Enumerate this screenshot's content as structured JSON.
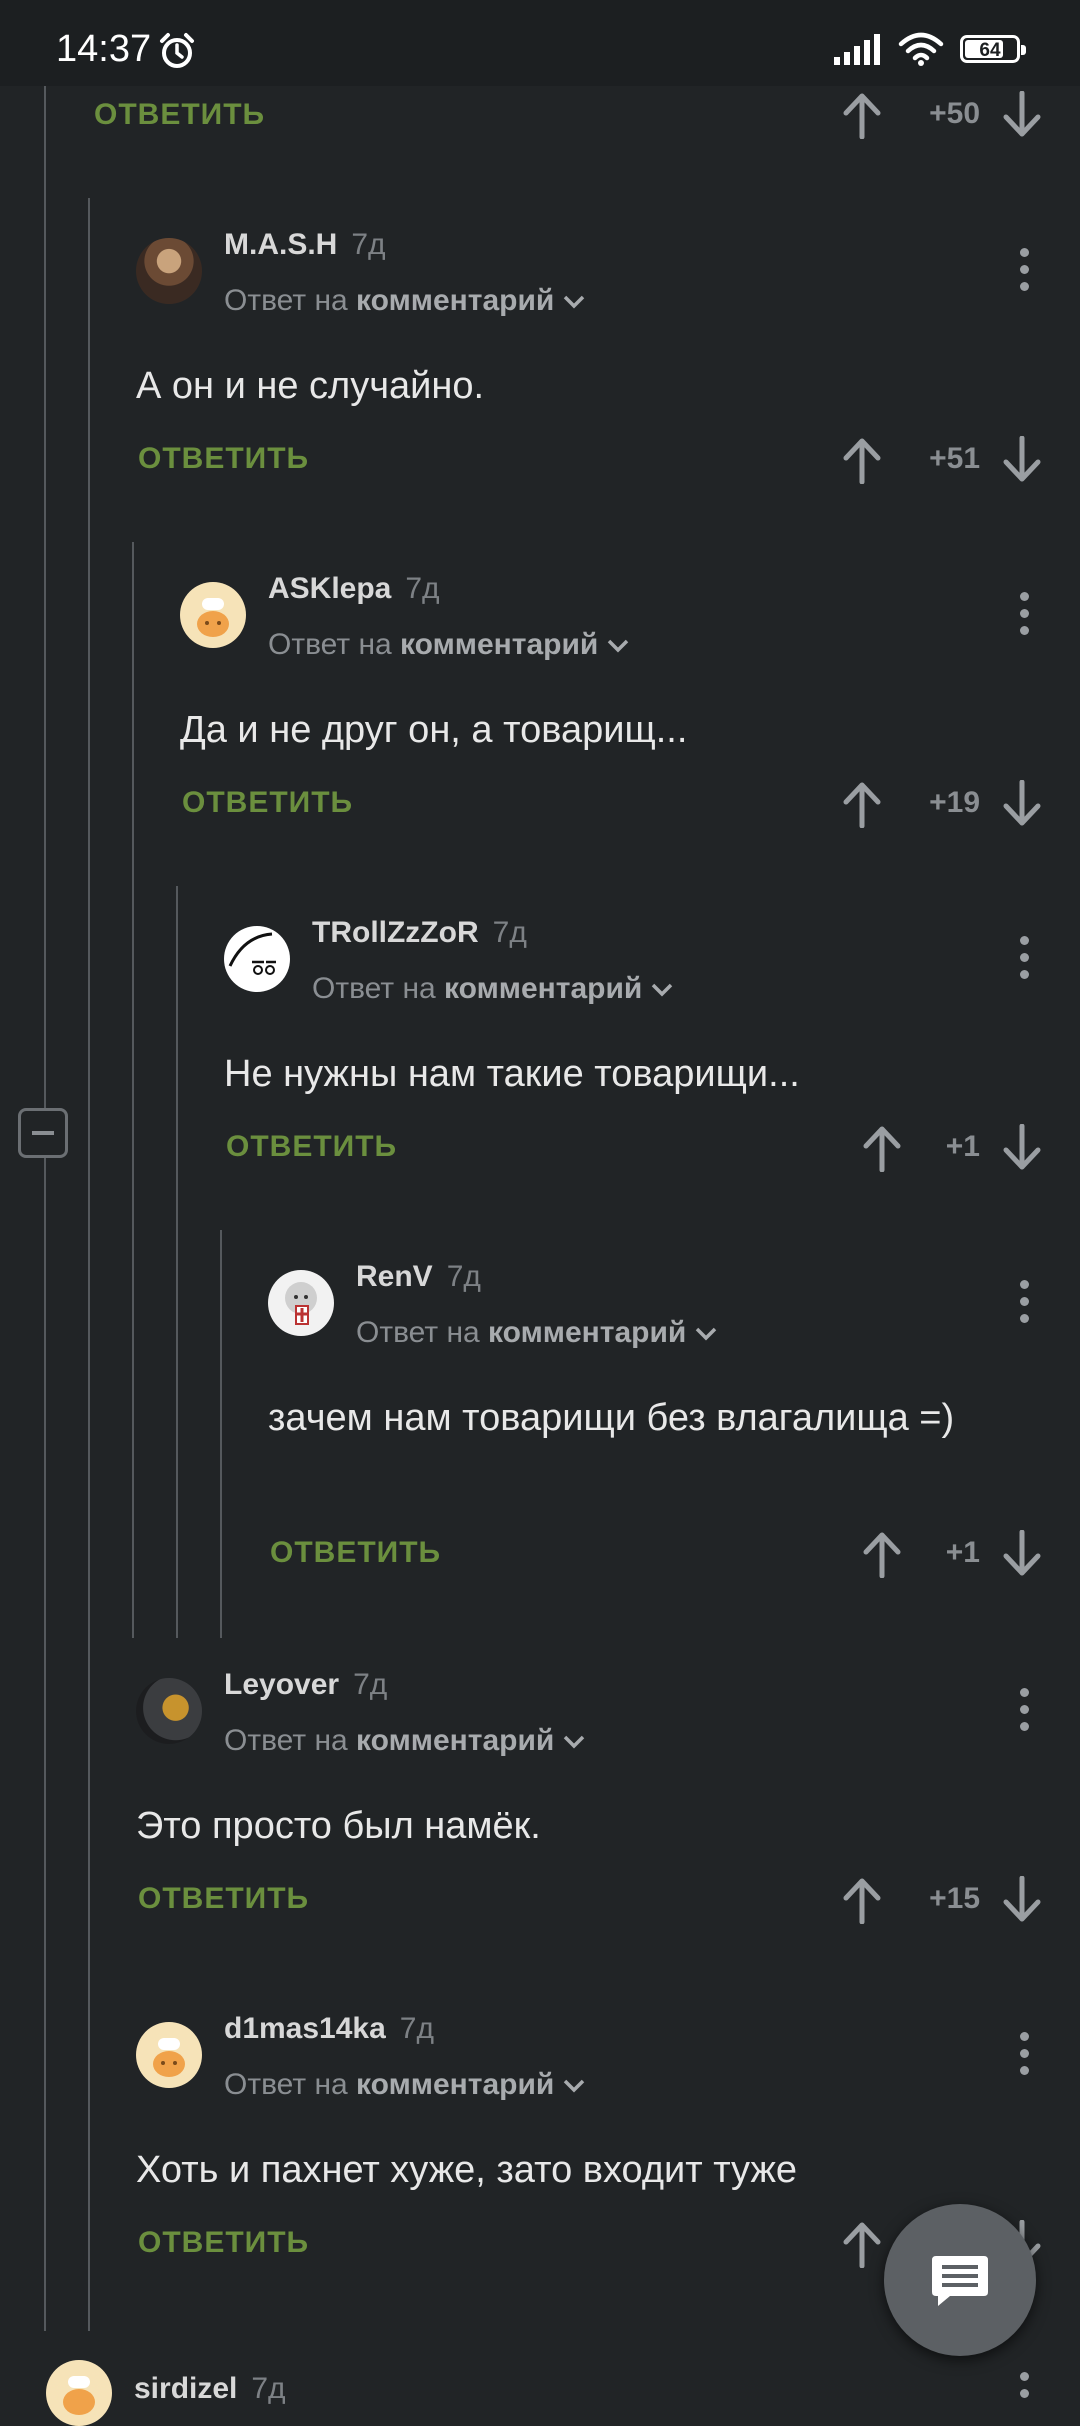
{
  "status_bar": {
    "time": "14:37",
    "battery": "64"
  },
  "labels": {
    "reply_to": "Ответ на",
    "comment_word": "комментарий",
    "reply_action": "ОТВЕТИТЬ"
  },
  "top_vote": {
    "score": "+50"
  },
  "comments": [
    {
      "author": "M.A.S.H",
      "age": "7д",
      "text": "А он и не случайно.",
      "score": "+51"
    },
    {
      "author": "ASKlepa",
      "age": "7д",
      "text": "Да и не друг он, а товарищ...",
      "score": "+19"
    },
    {
      "author": "TRollZzZoR",
      "age": "7д",
      "text": "Не нужны нам такие товарищи...",
      "score": "+1"
    },
    {
      "author": "RenV",
      "age": "7д",
      "text": "зачем нам товарищи без влагалища =)",
      "score": "+1"
    },
    {
      "author": "Leyover",
      "age": "7д",
      "text": "Это просто был намёк.",
      "score": "+15"
    },
    {
      "author": "d1mas14ka",
      "age": "7д",
      "text": "Хоть и пахнет хуже, зато входит туже",
      "score": ""
    },
    {
      "author": "sirdizel",
      "age": "7д"
    }
  ],
  "colors": {
    "background": "#212426",
    "reply_green": "#6b8f3e",
    "muted": "#8a8e92"
  }
}
